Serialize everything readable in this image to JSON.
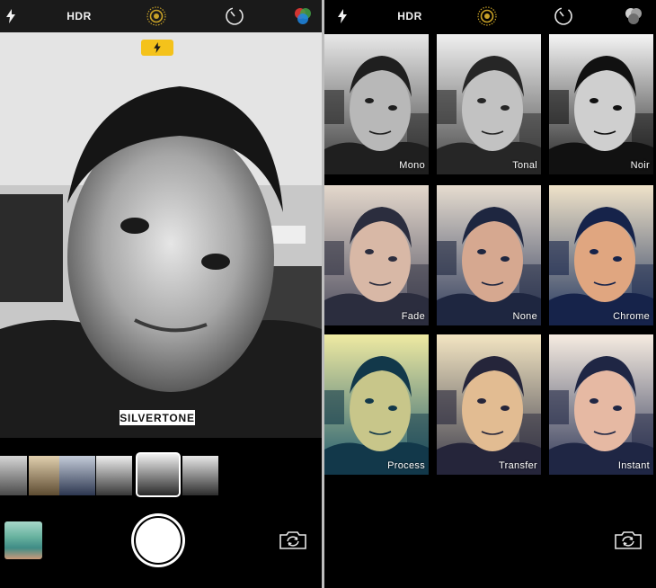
{
  "left": {
    "topbar": {
      "hdr_label": "HDR"
    },
    "flash_indicator": "flash-icon",
    "filter_label": "SILVERTONE",
    "strip_thumbs": 6,
    "selected_thumb_index": 4
  },
  "right": {
    "topbar": {
      "hdr_label": "HDR"
    },
    "filters": [
      {
        "label": "Mono",
        "tone": "mono"
      },
      {
        "label": "Tonal",
        "tone": "tonal"
      },
      {
        "label": "Noir",
        "tone": "noir"
      },
      {
        "label": "Fade",
        "tone": "fade"
      },
      {
        "label": "None",
        "tone": "none"
      },
      {
        "label": "Chrome",
        "tone": "chrome"
      },
      {
        "label": "Process",
        "tone": "process"
      },
      {
        "label": "Transfer",
        "tone": "transfer"
      },
      {
        "label": "Instant",
        "tone": "instant"
      }
    ]
  },
  "colors": {
    "accent_yellow": "#f4c21b",
    "live_photo_gold": "#c9a227",
    "panel_bg": "#000000",
    "topbar_left_bg": "#1a1a1a"
  },
  "icons": [
    "flash-icon",
    "live-photo-icon",
    "timer-icon",
    "filters-icon",
    "camera-switch-icon"
  ]
}
